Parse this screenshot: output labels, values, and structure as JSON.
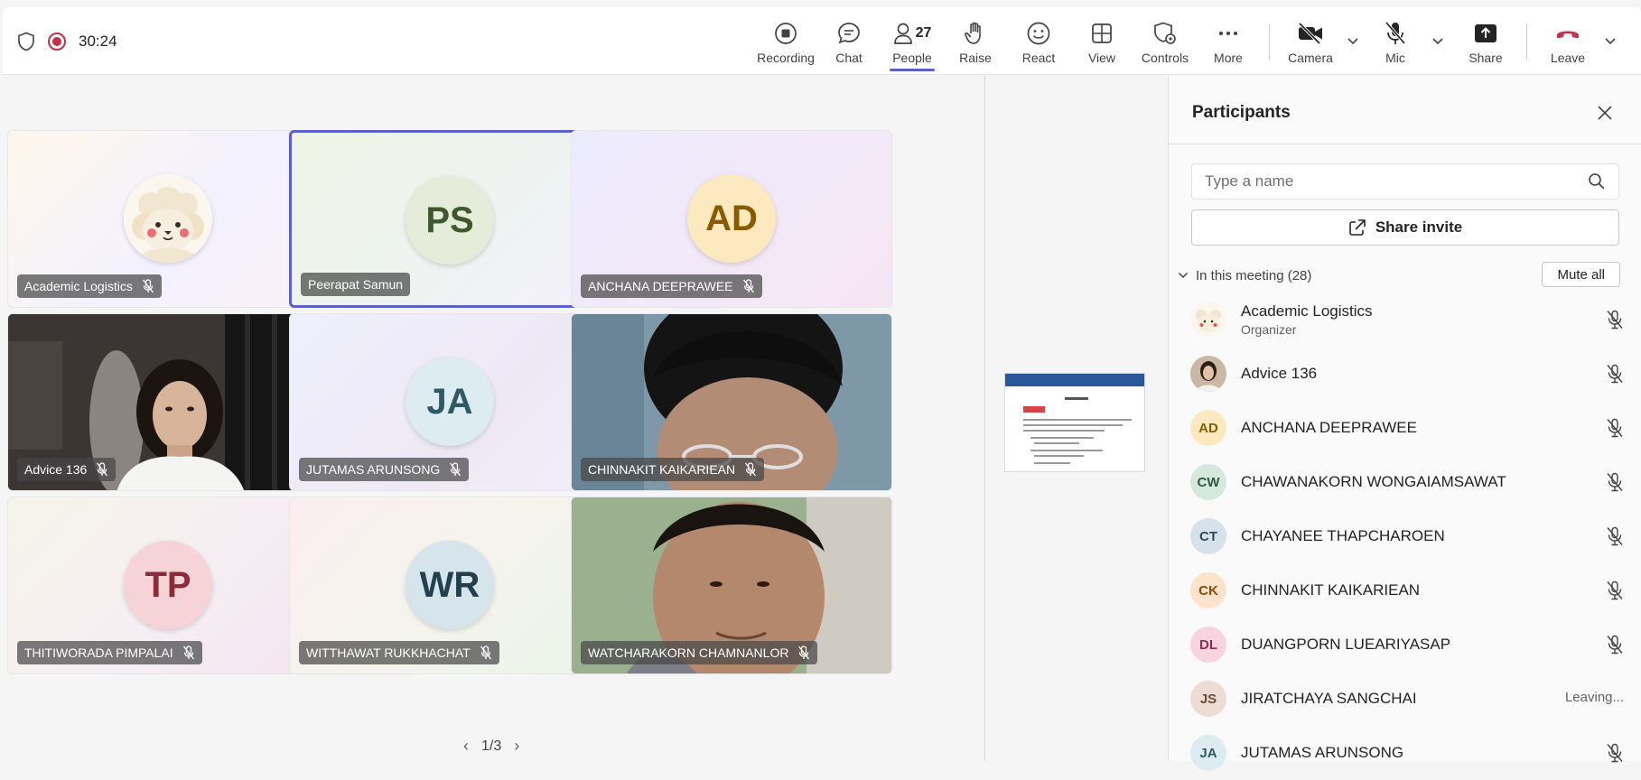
{
  "topbar": {
    "timer": "30:24",
    "tools": [
      {
        "label": "Recording"
      },
      {
        "label": "Chat"
      },
      {
        "label": "People",
        "count": "27"
      },
      {
        "label": "Raise"
      },
      {
        "label": "React"
      },
      {
        "label": "View"
      },
      {
        "label": "Controls"
      },
      {
        "label": "More"
      }
    ],
    "camera": "Camera",
    "mic": "Mic",
    "share": "Share",
    "leave": "Leave"
  },
  "stage": {
    "tiles": [
      {
        "name": "Academic Logistics"
      },
      {
        "name": "Peerapat Samun",
        "initials": "PS"
      },
      {
        "name": "ANCHANA DEEPRAWEE",
        "initials": "AD"
      },
      {
        "name": "Advice 136"
      },
      {
        "name": "JUTAMAS ARUNSONG",
        "initials": "JA"
      },
      {
        "name": "CHINNAKIT KAIKARIEAN"
      },
      {
        "name": "THITIWORADA PIMPALAI",
        "initials": "TP"
      },
      {
        "name": "WITTHAWAT RUKKHACHAT",
        "initials": "WR"
      },
      {
        "name": "WATCHARAKORN CHAMNANLOR"
      }
    ],
    "page": "1/3"
  },
  "panel": {
    "title": "Participants",
    "search_placeholder": "Type a name",
    "share_invite": "Share invite",
    "section": "In this meeting (28)",
    "mute_all": "Mute all",
    "participants": [
      {
        "name": "Academic Logistics",
        "role": "Organizer",
        "initials": ""
      },
      {
        "name": "Advice 136",
        "initials": ""
      },
      {
        "name": "ANCHANA DEEPRAWEE",
        "initials": "AD"
      },
      {
        "name": "CHAWANAKORN WONGAIAMSAWAT",
        "initials": "CW"
      },
      {
        "name": "CHAYANEE THAPCHAROEN",
        "initials": "CT"
      },
      {
        "name": "CHINNAKIT KAIKARIEAN",
        "initials": "CK"
      },
      {
        "name": "DUANGPORN LUEARIYASAP",
        "initials": "DL"
      },
      {
        "name": "JIRATCHAYA SANGCHAI",
        "initials": "JS",
        "status": "Leaving..."
      },
      {
        "name": "JUTAMAS ARUNSONG",
        "initials": "JA"
      }
    ]
  },
  "colors": {
    "accent": "#5b5fc7",
    "recording": "#c4314b",
    "leave": "#c4314b"
  }
}
